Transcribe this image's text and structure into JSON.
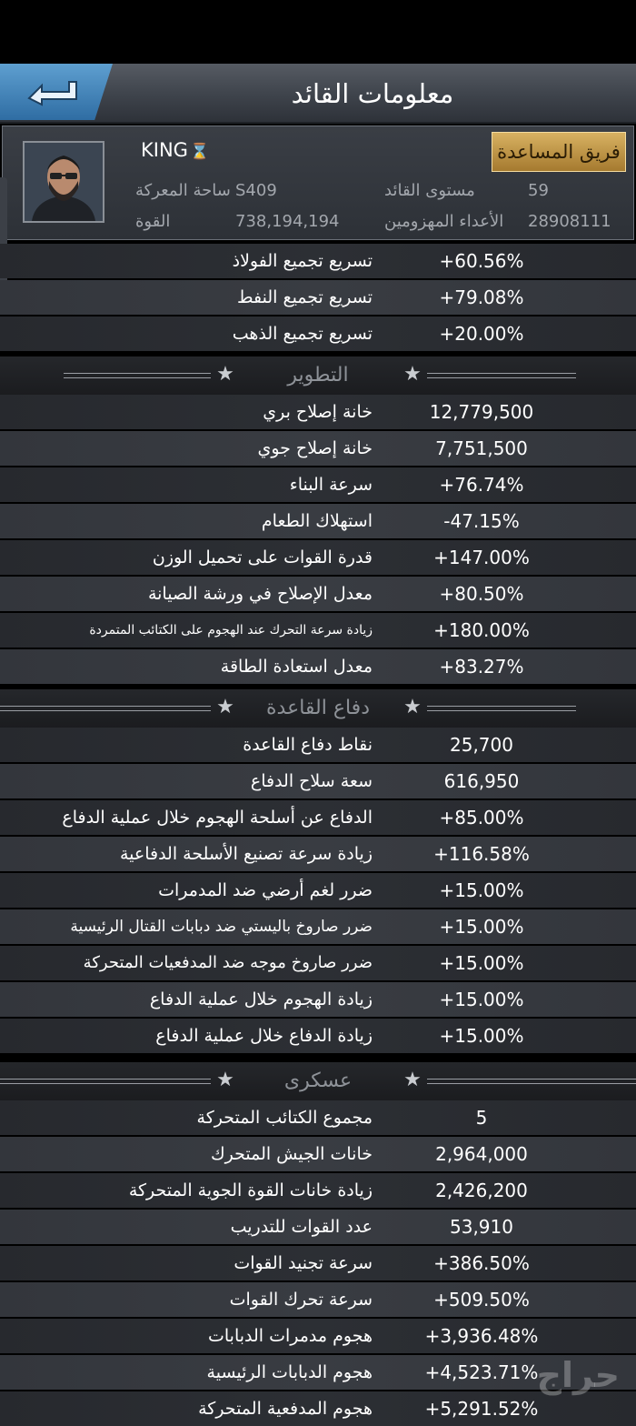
{
  "header": {
    "title": "معلومات القائد"
  },
  "profile": {
    "name": "KING",
    "assist_button": "فريق المساعدة",
    "battlefield_label": "ساحة المعركة",
    "battlefield_value": "S409",
    "level_label": "مستوى القائد",
    "level_value": "59",
    "power_label": "القوة",
    "power_value": "738,194,194",
    "defeated_label": "الأعداء المهزومين",
    "defeated_value": "28908111"
  },
  "gathering": [
    {
      "label": "تسريع تجميع الفولاذ",
      "value": "+60.56%"
    },
    {
      "label": "تسريع تجميع النفط",
      "value": "+79.08%"
    },
    {
      "label": "تسريع تجميع الذهب",
      "value": "+20.00%"
    }
  ],
  "sections": {
    "development": "التطوير",
    "base_defense": "دفاع القاعدة",
    "military": "عسكرى"
  },
  "development": [
    {
      "label": "خانة إصلاح بري",
      "value": "12,779,500"
    },
    {
      "label": "خانة إصلاح جوي",
      "value": "7,751,500"
    },
    {
      "label": "سرعة البناء",
      "value": "+76.74%"
    },
    {
      "label": "استهلاك الطعام",
      "value": "-47.15%"
    },
    {
      "label": "قدرة القوات على تحميل الوزن",
      "value": "+147.00%"
    },
    {
      "label": "معدل الإصلاح في ورشة الصيانة",
      "value": "+80.50%"
    },
    {
      "label": "زيادة سرعة التحرك عند الهجوم على الكتائب المتمردة",
      "value": "+180.00%"
    },
    {
      "label": "معدل استعادة الطاقة",
      "value": "+83.27%"
    }
  ],
  "base_defense": [
    {
      "label": "نقاط دفاع القاعدة",
      "value": "25,700"
    },
    {
      "label": "سعة سلاح الدفاع",
      "value": "616,950"
    },
    {
      "label": "الدفاع عن أسلحة الهجوم خلال عملية الدفاع",
      "value": "+85.00%"
    },
    {
      "label": "زيادة سرعة تصنيع الأسلحة الدفاعية",
      "value": "+116.58%"
    },
    {
      "label": "ضرر لغم أرضي ضد المدمرات",
      "value": "+15.00%"
    },
    {
      "label": "ضرر صاروخ باليستي ضد دبابات القتال الرئيسية",
      "value": "+15.00%"
    },
    {
      "label": "ضرر صاروخ موجه ضد المدفعيات المتحركة",
      "value": "+15.00%"
    },
    {
      "label": "زيادة الهجوم خلال عملية الدفاع",
      "value": "+15.00%"
    },
    {
      "label": "زيادة الدفاع خلال عملية الدفاع",
      "value": "+15.00%"
    }
  ],
  "military": [
    {
      "label": "مجموع الكتائب المتحركة",
      "value": "5"
    },
    {
      "label": "خانات الجيش المتحرك",
      "value": "2,964,000"
    },
    {
      "label": "زيادة خانات القوة الجوية المتحركة",
      "value": "2,426,200"
    },
    {
      "label": "عدد القوات للتدريب",
      "value": "53,910"
    },
    {
      "label": "سرعة تجنيد القوات",
      "value": "+386.50%"
    },
    {
      "label": "سرعة تحرك القوات",
      "value": "+509.50%"
    },
    {
      "label": "هجوم مدمرات الدبابات",
      "value": "+3,936.48%"
    },
    {
      "label": "هجوم الدبابات الرئيسية",
      "value": "+4,523.71%"
    },
    {
      "label": "هجوم المدفعية المتحركة",
      "value": "+5,291.52%"
    }
  ],
  "watermark": "حراج",
  "colors": {
    "accent_gold": "#c9a052",
    "back_button_blue": "#3f7fb5"
  }
}
